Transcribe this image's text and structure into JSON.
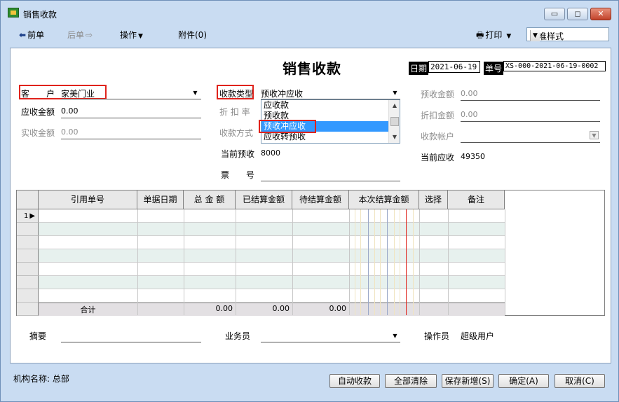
{
  "window": {
    "title": "销售收款",
    "minimize_glyph": "▭",
    "restore_glyph": "◻",
    "close_glyph": "✕"
  },
  "toolbar": {
    "prev": "前单",
    "next": "后单",
    "actions": "操作",
    "attachments": "附件(0)",
    "print": "打印",
    "style_value": "标准样式"
  },
  "form": {
    "title": "销售收款",
    "date_label": "日期",
    "date_value": "2021-06-19",
    "no_label": "单号",
    "no_value": "XS-000-2021-06-19-0002",
    "customer_label": "客　　户",
    "customer_value": "家美门业",
    "receivable_label": "应收金额",
    "receivable_value": "0.00",
    "actual_label": "实收金额",
    "actual_value": "0.00",
    "type_label": "收款类型",
    "type_value": "预收冲应收",
    "discount_rate_label": "折 扣 率",
    "pay_method_label": "收款方式",
    "current_prepaid_label": "当前预收",
    "current_prepaid_value": "8000",
    "ticket_label": "票　　号",
    "prepaid_amount_label": "预收金额",
    "prepaid_amount_value": "0.00",
    "discount_amount_label": "折扣金额",
    "discount_amount_value": "0.00",
    "account_label": "收款帐户",
    "current_receivable_label": "当前应收",
    "current_receivable_value": "49350",
    "type_options": [
      "应收款",
      "预收款",
      "预收冲应收",
      "应收转预收"
    ]
  },
  "grid": {
    "columns": [
      "引用单号",
      "单据日期",
      "总 金 额",
      "已结算金额",
      "待结算金额",
      "本次结算金额",
      "选择",
      "备注"
    ],
    "first_row_num": "1",
    "total_label": "合计",
    "total_amount": "0.00",
    "total_settled": "0.00",
    "total_pending": "0.00"
  },
  "bottom": {
    "summary_label": "摘要",
    "salesperson_label": "业务员",
    "operator_label": "操作员",
    "operator_value": "超级用户"
  },
  "status": {
    "org": "机构名称: 总部"
  },
  "buttons": {
    "auto": "自动收款",
    "clear": "全部清除",
    "save_new": "保存新增(S)",
    "ok": "确定(A)",
    "cancel": "取消(C)"
  }
}
